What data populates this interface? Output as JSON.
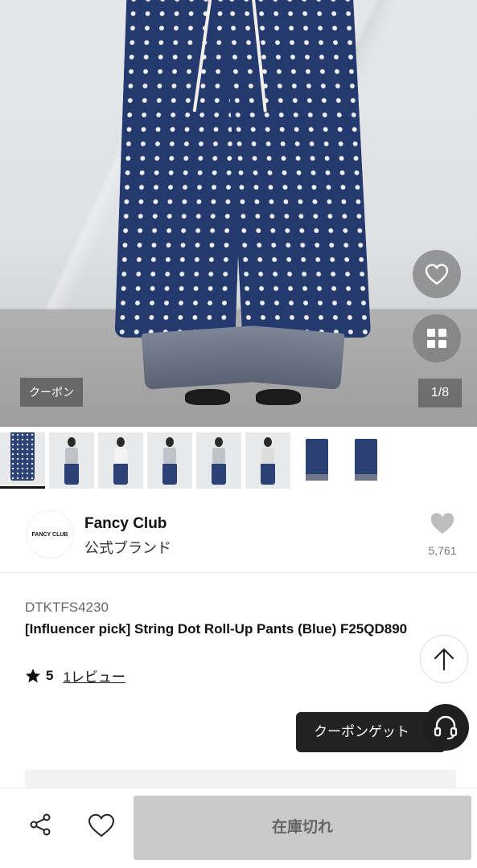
{
  "gallery": {
    "coupon_tag": "クーポン",
    "page_indicator": "1/8",
    "thumbnail_count": 8
  },
  "brand": {
    "logo_text": "FANCY CLUB",
    "name": "Fancy Club",
    "subtitle": "公式ブランド",
    "favorite_count": "5,761"
  },
  "product": {
    "code": "DTKTFS4230",
    "title": "[Influencer pick] String Dot Roll-Up Pants (Blue) F25QD890",
    "rating": "5",
    "review_link": "1レビュー"
  },
  "floating": {
    "coupon_get_label": "クーポンゲット"
  },
  "bottom_bar": {
    "buy_button_label": "在庫切れ"
  },
  "colors": {
    "denim": "#243a6e",
    "button_disabled": "#c9c9c9"
  }
}
